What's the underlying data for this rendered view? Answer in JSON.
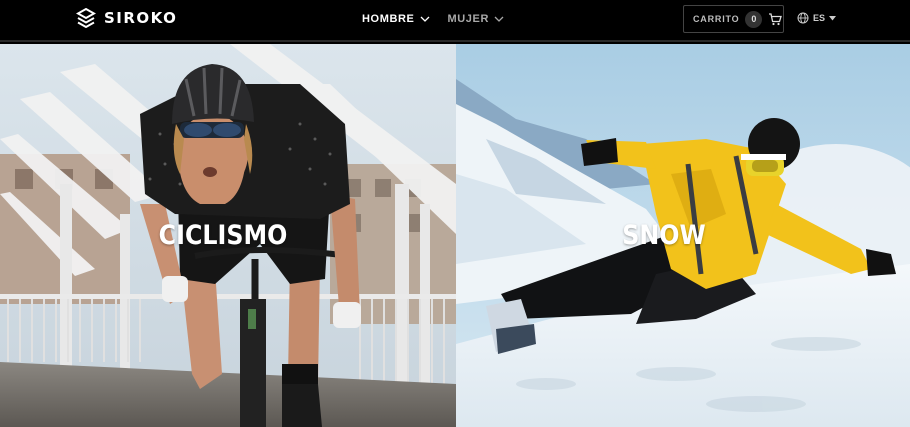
{
  "header": {
    "brand": "SIROKO",
    "nav": [
      {
        "label": "HOMBRE",
        "icon": "chevron-down-icon"
      },
      {
        "label": "MUJER",
        "icon": "chevron-down-icon"
      }
    ],
    "cart": {
      "label": "CARRITO",
      "count": "0",
      "icon": "cart-icon"
    },
    "language": {
      "label": "ES",
      "icon": "globe-icon"
    }
  },
  "panels": [
    {
      "title": "CICLISMO"
    },
    {
      "title": "SNOW"
    }
  ],
  "colors": {
    "header_bg": "#000000",
    "snow_jacket": "#f2c21b",
    "sky_left": "#d6e2ea",
    "sky_right": "#b9d7ea"
  }
}
